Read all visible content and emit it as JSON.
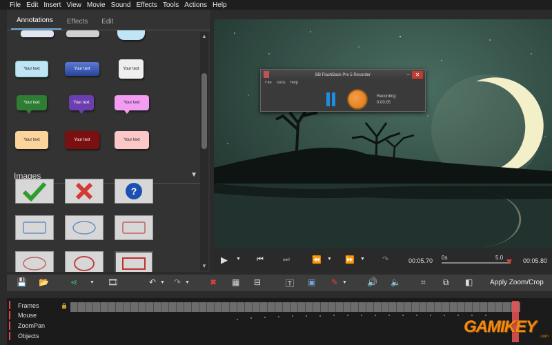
{
  "menu": {
    "items": [
      "File",
      "Edit",
      "Insert",
      "View",
      "Movie",
      "Sound",
      "Effects",
      "Tools",
      "Actions",
      "Help"
    ]
  },
  "panel": {
    "tabs": [
      "Annotations",
      "Effects",
      "Edit"
    ],
    "active_tab": "Annotations",
    "callout_text": "Your text",
    "images_header": "Images"
  },
  "recorder": {
    "title": "BB FlashBack Pro 5 Recorder",
    "menu": [
      "File",
      "Tools",
      "Help"
    ],
    "status_label": "Recording:",
    "status_time": "0:00:05"
  },
  "transport": {
    "current_time": "00:05.70",
    "slider_start": "0s",
    "slider_end": "5.0",
    "total_time": "00:05.80",
    "playhead_fraction": 0.98
  },
  "toolbar": {
    "apply_zoom_label": "Apply Zoom/Crop"
  },
  "timeline": {
    "tracks": [
      "Frames",
      "Mouse",
      "ZoomPan",
      "Objects"
    ]
  },
  "watermark": {
    "text": "GAMIKEY",
    "suffix": ".com"
  },
  "colors": {
    "accent": "#6fa8dc",
    "record": "#e0700f",
    "pause": "#1d8fe0",
    "close": "#c23b2f",
    "timeline_marker": "#e95353"
  }
}
